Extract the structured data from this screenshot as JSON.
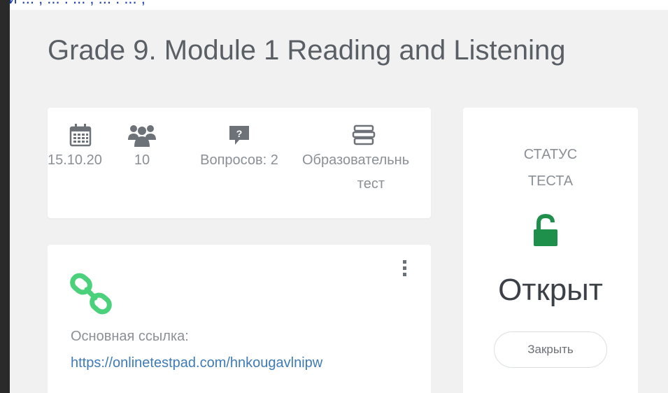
{
  "top_banner": {
    "text": ", и ... , ... . ... , ... . ... ,"
  },
  "test": {
    "title": "Grade 9. Module 1 Reading and Listening"
  },
  "info": {
    "date_icon": "calendar-icon",
    "date": "15.10.20",
    "users_icon": "users-icon",
    "participants": "10",
    "questions_icon": "question-bubble-icon",
    "questions": "Вопросов: 2",
    "type_icon": "books-stack-icon",
    "type_line1": "Образовательнь",
    "type_line2": "тест"
  },
  "link": {
    "icon": "link-chain-icon",
    "menu_icon": "kebab-menu-icon",
    "label": "Основная ссылка:",
    "url": "https://onlinetestpad.com/hnkougavlnipw"
  },
  "status": {
    "heading_line1": "СТАТУС",
    "heading_line2": "ТЕСТА",
    "lock_icon": "unlocked-padlock-icon",
    "value": "Открыт",
    "close_label": "Закрыть"
  },
  "colors": {
    "accent_green": "#1f8f4c",
    "link_icon_green": "#4bd17c",
    "link_blue": "#3e7bb6",
    "page_bg": "#f1f1f1",
    "card_bg": "#ffffff",
    "muted_text": "#8a9096"
  }
}
